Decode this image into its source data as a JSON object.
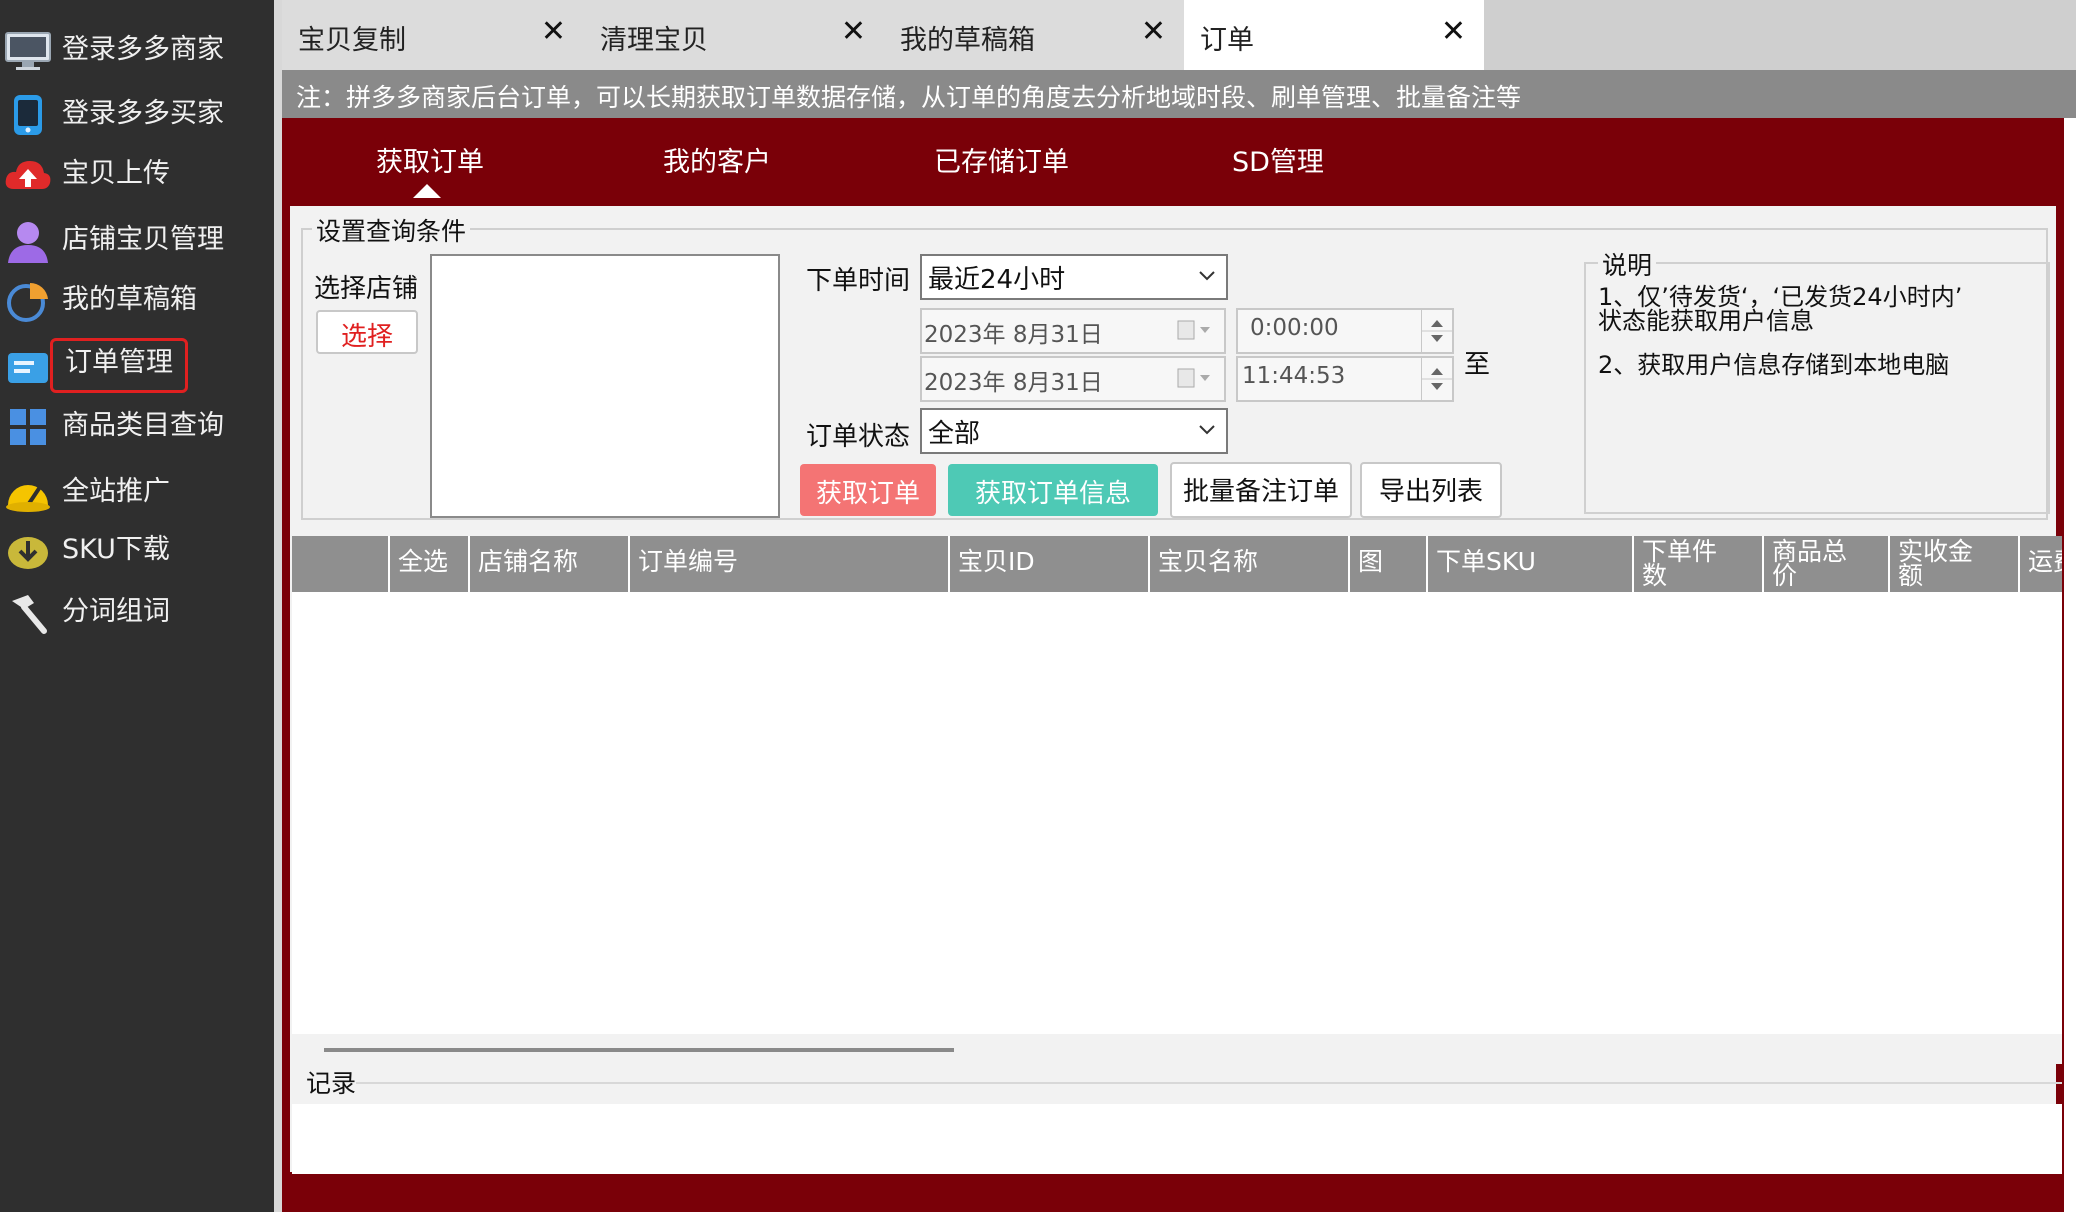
{
  "sidebar": {
    "items": [
      {
        "label": "登录多多商家",
        "icon": "monitor-icon"
      },
      {
        "label": "登录多多买家",
        "icon": "phone-icon"
      },
      {
        "label": "宝贝上传",
        "icon": "cloud-upload-icon"
      },
      {
        "label": "店铺宝贝管理",
        "icon": "user-icon"
      },
      {
        "label": "我的草稿箱",
        "icon": "pie-chart-icon"
      },
      {
        "label": "订单管理",
        "icon": "folder-icon",
        "active": true
      },
      {
        "label": "商品类目查询",
        "icon": "grid-icon"
      },
      {
        "label": "全站推广",
        "icon": "speedometer-icon"
      },
      {
        "label": "SKU下载",
        "icon": "download-circle-icon"
      },
      {
        "label": "分词组词",
        "icon": "hammer-icon"
      }
    ]
  },
  "tabs": [
    {
      "label": "宝贝复制",
      "close": "✕"
    },
    {
      "label": "清理宝贝",
      "close": "✕"
    },
    {
      "label": "我的草稿箱",
      "close": "✕"
    },
    {
      "label": "订单",
      "close": "✕",
      "active": true
    }
  ],
  "notice": "注：拼多多商家后台订单，可以长期获取订单数据存储，从订单的角度去分析地域时段、刷单管理、批量备注等",
  "subtabs": [
    "获取订单",
    "我的客户",
    "已存储订单",
    "SD管理"
  ],
  "query": {
    "legend": "设置查询条件",
    "shop_label": "选择店铺",
    "choose_button": "选择",
    "time_label": "下单时间",
    "time_range_value": "最近24小时",
    "start_date": "2023年  8月31日",
    "end_date": "2023年  8月31日",
    "start_time": "0:00:00",
    "end_time": "11:44:53",
    "to_label": "至",
    "status_label": "订单状态",
    "status_value": "全部",
    "buttons": {
      "get_orders": "获取订单",
      "get_info": "获取订单信息",
      "batch_note": "批量备注订单",
      "export": "导出列表"
    }
  },
  "description": {
    "legend": "说明",
    "line1": "1、仅’待发货‘，‘已发货24小时内’",
    "line1b": "状态能获取用户信息",
    "line2": "2、获取用户信息存储到本地电脑"
  },
  "table": {
    "columns": [
      "",
      "全选",
      "店铺名称",
      "订单编号",
      "宝贝ID",
      "宝贝名称",
      "图",
      "下单SKU",
      "下单件|数",
      "商品总|价",
      "实收金|额",
      "运费"
    ]
  },
  "record": {
    "legend": "记录"
  },
  "colors": {
    "sidebar_bg": "#2f2f2f",
    "frame_red": "#7a0008",
    "btn_red": "#f47474",
    "btn_teal": "#4ec9b5",
    "active_outline": "#e02020"
  }
}
